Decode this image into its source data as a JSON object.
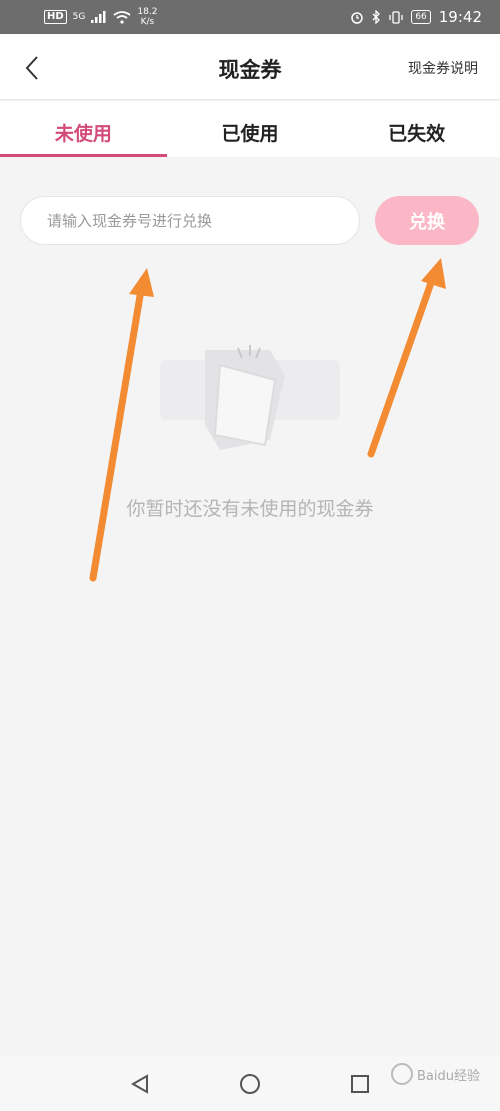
{
  "status_bar": {
    "hd": "HD",
    "network": "5G",
    "speed_value": "18.2",
    "speed_unit": "K/s",
    "battery": "66",
    "time": "19:42"
  },
  "header": {
    "title": "现金券",
    "help_link": "现金券说明",
    "back_icon": "chevron-left-icon"
  },
  "tabs": [
    {
      "label": "未使用",
      "active": true
    },
    {
      "label": "已使用",
      "active": false
    },
    {
      "label": "已失效",
      "active": false
    }
  ],
  "redeem": {
    "placeholder": "请输入现金券号进行兑换",
    "value": "",
    "button_label": "兑换"
  },
  "empty_state": {
    "message": "你暂时还没有未使用的现金券"
  },
  "watermark": "Baidu经验",
  "colors": {
    "accent": "#d24b7a",
    "button_pink": "#fbb7c6",
    "arrow": "#f28b32"
  }
}
